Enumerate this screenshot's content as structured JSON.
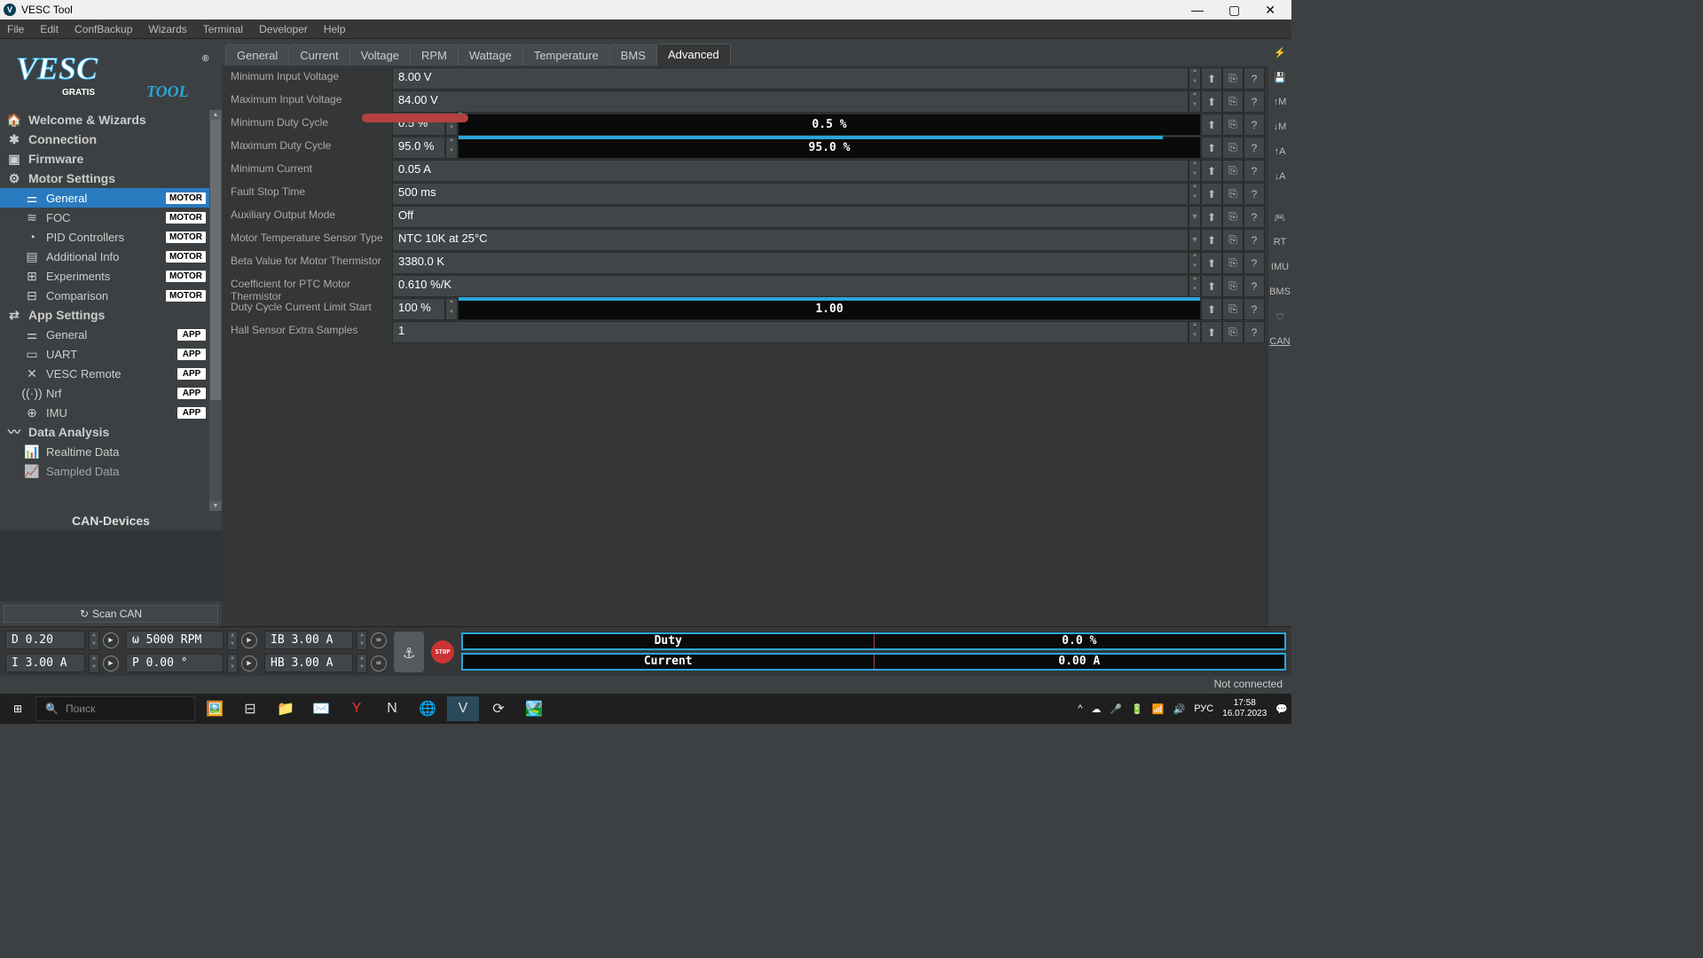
{
  "window": {
    "title": "VESC Tool"
  },
  "menu": [
    "File",
    "Edit",
    "ConfBackup",
    "Wizards",
    "Terminal",
    "Developer",
    "Help"
  ],
  "sidebar": {
    "sections": [
      {
        "label": "Welcome & Wizards"
      },
      {
        "label": "Connection"
      },
      {
        "label": "Firmware"
      },
      {
        "label": "Motor Settings",
        "items": [
          {
            "label": "General",
            "badge": "MOTOR",
            "active": true
          },
          {
            "label": "FOC",
            "badge": "MOTOR"
          },
          {
            "label": "PID Controllers",
            "badge": "MOTOR"
          },
          {
            "label": "Additional Info",
            "badge": "MOTOR"
          },
          {
            "label": "Experiments",
            "badge": "MOTOR"
          },
          {
            "label": "Comparison",
            "badge": "MOTOR"
          }
        ]
      },
      {
        "label": "App Settings",
        "items": [
          {
            "label": "General",
            "badge": "APP"
          },
          {
            "label": "UART",
            "badge": "APP"
          },
          {
            "label": "VESC Remote",
            "badge": "APP"
          },
          {
            "label": "Nrf",
            "badge": "APP"
          },
          {
            "label": "IMU",
            "badge": "APP"
          }
        ]
      },
      {
        "label": "Data Analysis",
        "items": [
          {
            "label": "Realtime Data"
          },
          {
            "label": "Sampled Data"
          }
        ]
      }
    ],
    "can_header": "CAN-Devices",
    "scan": "Scan CAN"
  },
  "tabs": [
    "General",
    "Current",
    "Voltage",
    "RPM",
    "Wattage",
    "Temperature",
    "BMS",
    "Advanced"
  ],
  "active_tab": 7,
  "settings": [
    {
      "label": "Minimum Input Voltage",
      "value": "8.00 V",
      "type": "spin"
    },
    {
      "label": "Maximum Input Voltage",
      "value": "84.00 V",
      "type": "spin"
    },
    {
      "label": "Minimum Duty Cycle",
      "value": "0.5 %",
      "type": "spin_slider",
      "slider_label": "0.5 %",
      "slider_pct": 0.5
    },
    {
      "label": "Maximum Duty Cycle",
      "value": "95.0 %",
      "type": "spin_slider",
      "slider_label": "95.0 %",
      "slider_pct": 95
    },
    {
      "label": "Minimum Current",
      "value": "0.05 A",
      "type": "spin"
    },
    {
      "label": "Fault Stop Time",
      "value": "500 ms",
      "type": "spin"
    },
    {
      "label": "Auxiliary Output Mode",
      "value": "Off",
      "type": "dropdown"
    },
    {
      "label": "Motor Temperature Sensor Type",
      "value": "NTC 10K at 25°C",
      "type": "dropdown"
    },
    {
      "label": "Beta Value for Motor Thermistor",
      "value": "3380.0 K",
      "type": "spin"
    },
    {
      "label": "Coefficient for PTC Motor Thermistor",
      "value": "0.610 %/K",
      "type": "spin"
    },
    {
      "label": "Duty Cycle Current Limit Start",
      "value": "100 %",
      "type": "spin_slider",
      "slider_label": "1.00",
      "slider_pct": 100
    },
    {
      "label": "Hall Sensor Extra Samples",
      "value": "1",
      "type": "spin"
    }
  ],
  "bottom": {
    "d": "D 0.20",
    "i": "I 3.00 A",
    "w": "ω 5000 RPM",
    "p": "P 0.00 °",
    "ib": "IB 3.00 A",
    "hb": "HB 3.00 A",
    "meter1_label": "Duty",
    "meter1_val": "0.0 %",
    "meter2_label": "Current",
    "meter2_val": "0.00 A"
  },
  "status": "Not connected",
  "taskbar": {
    "search": "Поиск",
    "lang": "РУС",
    "time": "17:58",
    "date": "16.07.2023"
  }
}
